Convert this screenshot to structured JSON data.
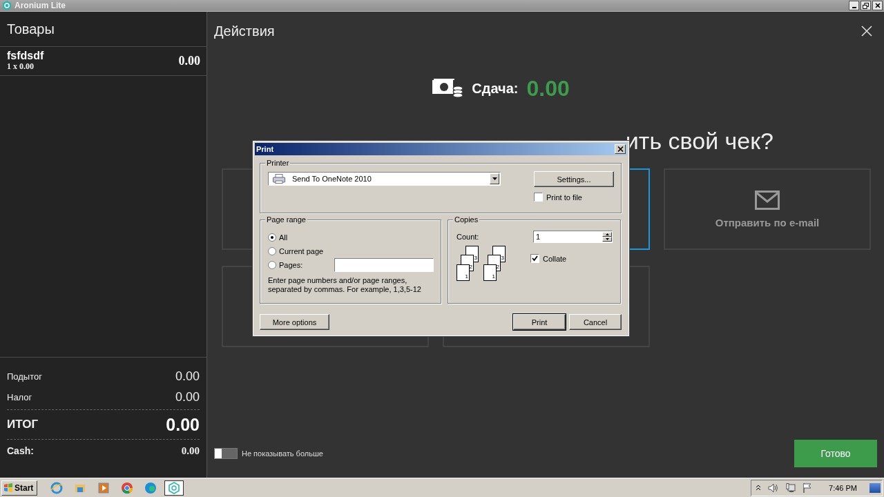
{
  "window": {
    "title": "Aronium Lite"
  },
  "cart": {
    "title": "Товары",
    "items": [
      {
        "name": "fsfdsdf",
        "qty": "1 x 0.00",
        "total": "0.00"
      }
    ],
    "totals": [
      {
        "label": "Подытог",
        "value": "0.00",
        "kind": "normal"
      },
      {
        "label": "Налог",
        "value": "0.00",
        "kind": "normal"
      },
      {
        "label": "ИТОГ",
        "value": "0.00",
        "kind": "grand"
      },
      {
        "label": "Cash:",
        "value": "0.00",
        "kind": "payment"
      }
    ]
  },
  "actions": {
    "title": "Действия",
    "change": {
      "label": "Сдача:",
      "value": "0.00"
    },
    "question": "ить свой чек?",
    "options": [
      {
        "kind": "covered",
        "selected": false
      },
      {
        "kind": "covered",
        "selected": true
      },
      {
        "kind": "email",
        "label": "Отправить по e-mail",
        "selected": false
      },
      {
        "kind": "covered",
        "selected": false
      },
      {
        "kind": "covered",
        "selected": false
      }
    ],
    "dont_show": {
      "label": "Не показывать больше",
      "on": false
    },
    "done": "Готово"
  },
  "print_dialog": {
    "title": "Print",
    "printer": {
      "legend": "Printer",
      "value": "Send To OneNote 2010",
      "settings": "Settings...",
      "print_to_file": {
        "label": "Print to file",
        "checked": false
      }
    },
    "page_range": {
      "legend": "Page range",
      "options": [
        {
          "label": "All",
          "selected": true
        },
        {
          "label": "Current page",
          "selected": false
        },
        {
          "label": "Pages:",
          "selected": false
        }
      ],
      "hint_lines": [
        "Enter page numbers and/or page ranges,",
        "separated by commas. For example, 1,3,5-12"
      ]
    },
    "copies": {
      "legend": "Copies",
      "count_label": "Count:",
      "count": "1",
      "collate_stacks": [
        [
          "1",
          "2",
          "3"
        ],
        [
          "1",
          "2",
          "3"
        ]
      ],
      "collate": {
        "label": "Collate",
        "checked": true
      }
    },
    "buttons": [
      {
        "label": "More options",
        "kind": "secondary"
      },
      {
        "label": "Print",
        "kind": "default"
      },
      {
        "label": "Cancel",
        "kind": "secondary"
      }
    ]
  },
  "taskbar": {
    "start": "Start",
    "apps": [
      {
        "kind": "ie",
        "selected": false
      },
      {
        "kind": "folder",
        "selected": false
      },
      {
        "kind": "media",
        "selected": false
      },
      {
        "kind": "chrome",
        "selected": false
      },
      {
        "kind": "edge",
        "selected": false
      },
      {
        "kind": "aronium",
        "selected": true
      }
    ],
    "clock": "7:46 PM"
  }
}
